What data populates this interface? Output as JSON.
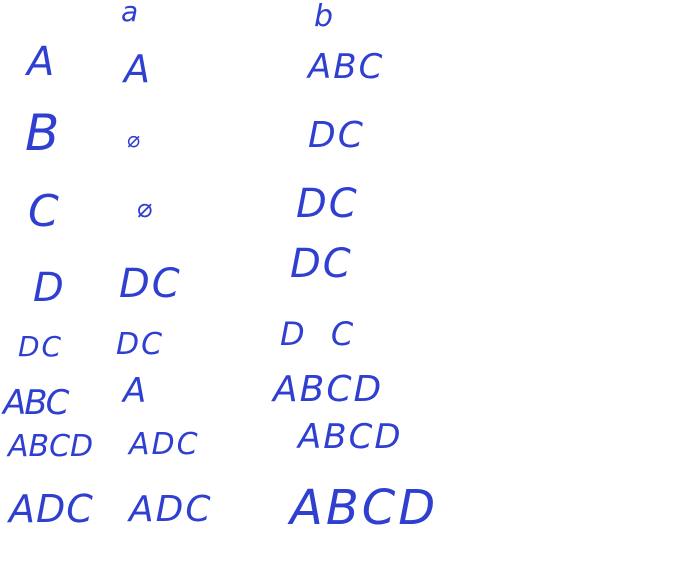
{
  "headers": {
    "a": "a",
    "b": "b"
  },
  "left_column": [
    "A",
    "B",
    "C",
    "D",
    "DC",
    "ABC",
    "ABCD",
    "ADC"
  ],
  "middle_column": [
    "A",
    "⌀",
    "⌀",
    "DC",
    "DC",
    "A",
    "ADC",
    "ADC"
  ],
  "right_column": [
    "ABC",
    "DC",
    "DC",
    "DC",
    "D C",
    "ABCD",
    "ABCD",
    "ABCD"
  ],
  "ink_color": "#2f3fd0"
}
